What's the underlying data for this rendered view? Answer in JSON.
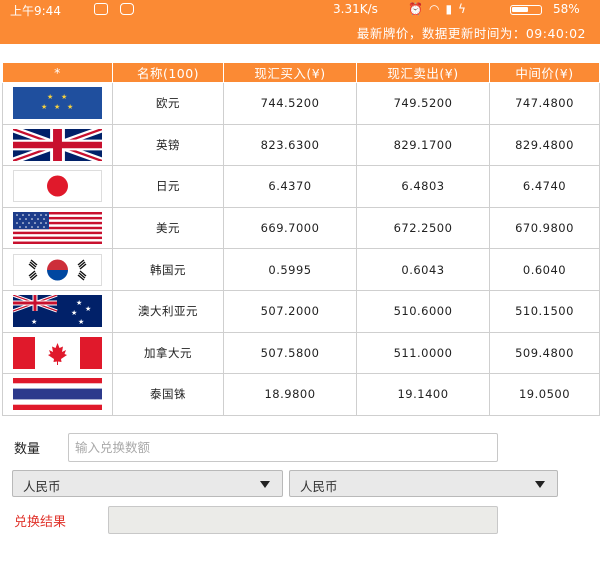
{
  "status_bar": {
    "time": "上午9:44",
    "speed": "3.31K/s",
    "battery": "58%",
    "battery_level": 0.58
  },
  "header": {
    "info": "最新牌价，数据更新时间为：09:40:02"
  },
  "table": {
    "headers": [
      "*",
      "名称(100)",
      "现汇买入(¥)",
      "现汇卖出(¥)",
      "中间价(¥)"
    ],
    "rows": [
      {
        "flag": "eu-flag-icon",
        "name": "欧元",
        "buy": "744.5200",
        "sell": "749.5200",
        "mid": "747.4800"
      },
      {
        "flag": "uk-flag-icon",
        "name": "英镑",
        "buy": "823.6300",
        "sell": "829.1700",
        "mid": "829.4800"
      },
      {
        "flag": "jp-flag-icon",
        "name": "日元",
        "buy": "6.4370",
        "sell": "6.4803",
        "mid": "6.4740"
      },
      {
        "flag": "us-flag-icon",
        "name": "美元",
        "buy": "669.7000",
        "sell": "672.2500",
        "mid": "670.9800"
      },
      {
        "flag": "kr-flag-icon",
        "name": "韩国元",
        "buy": "0.5995",
        "sell": "0.6043",
        "mid": "0.6040"
      },
      {
        "flag": "au-flag-icon",
        "name": "澳大利亚元",
        "buy": "507.2000",
        "sell": "510.6000",
        "mid": "510.1500"
      },
      {
        "flag": "ca-flag-icon",
        "name": "加拿大元",
        "buy": "507.5800",
        "sell": "511.0000",
        "mid": "509.4800"
      },
      {
        "flag": "th-flag-icon",
        "name": "泰国铢",
        "buy": "18.9800",
        "sell": "19.1400",
        "mid": "19.0500"
      }
    ]
  },
  "form": {
    "amount_label": "数量",
    "amount_placeholder": "输入兑换数额",
    "from_currency": "人民币",
    "to_currency": "人民币",
    "result_label": "兑换结果",
    "result_label_color": "#e0332b"
  },
  "colors": {
    "accent": "#fb8a34"
  }
}
